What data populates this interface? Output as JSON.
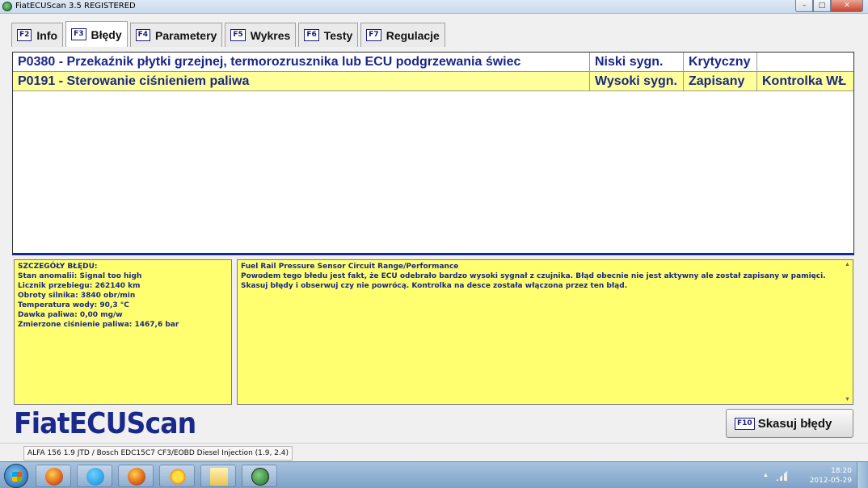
{
  "window": {
    "title": "FiatECUScan 3.5 REGISTERED"
  },
  "tabs": [
    {
      "key": "F2",
      "label": "Info"
    },
    {
      "key": "F3",
      "label": "Błędy"
    },
    {
      "key": "F4",
      "label": "Parametery"
    },
    {
      "key": "F5",
      "label": "Wykres"
    },
    {
      "key": "F6",
      "label": "Testy"
    },
    {
      "key": "F7",
      "label": "Regulacje"
    }
  ],
  "errors": [
    {
      "code_desc": "P0380 - Przekaźnik płytki grzejnej, termorozrusznika lub ECU podgrzewania świec",
      "signal": "Niski sygn.",
      "status": "Krytyczny",
      "lamp": ""
    },
    {
      "code_desc": "P0191 - Sterowanie ciśnieniem paliwa",
      "signal": "Wysoki sygn.",
      "status": "Zapisany",
      "lamp": "Kontrolka WŁ"
    }
  ],
  "details": {
    "lines": [
      "SZCZEGÓŁY BŁĘDU:",
      "Stan anomalii: Signal too high",
      "Licznik przebiegu: 262140 km",
      "Obroty silnika: 3840 obr/min",
      "Temperatura wody: 90,3 °C",
      "Dawka paliwa: 0,00 mg/w",
      "Zmierzone ciśnienie paliwa: 1467,6 bar"
    ]
  },
  "description": {
    "lines": [
      "Fuel Rail Pressure Sensor Circuit Range/Performance",
      "Powodem tego błedu jest fakt, że ECU odebrało bardzo wysoki sygnał z czujnika. Błąd obecnie nie jest aktywny ale został zapisany w pamięci.",
      "Skasuj błędy i obserwuj czy nie powrócą. Kontrolka na desce została włączona przez ten błąd."
    ]
  },
  "logo": "FiatECUScan",
  "clear_button": {
    "key": "F10",
    "label": "Skasuj błędy"
  },
  "statusbar": {
    "vehicle": "ALFA 156 1.9 JTD / Bosch EDC15C7 CF3/EOBD Diesel Injection (1.9, 2.4)"
  },
  "taskbar": {
    "apps": [
      "firefox-icon",
      "skype-icon",
      "firefox-icon",
      "sun-icon",
      "folder-icon",
      "fiatecuscan-icon"
    ],
    "time": "18:20",
    "date": "2012-05-29"
  }
}
